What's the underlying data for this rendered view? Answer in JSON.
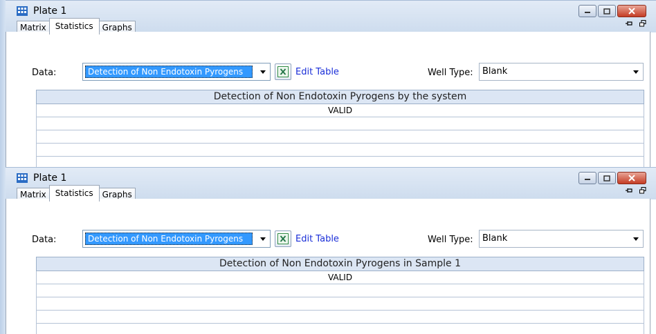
{
  "panels": [
    {
      "window_title": "Plate 1",
      "tabs": [
        "Matrix",
        "Statistics",
        "Graphs"
      ],
      "active_tab": "Statistics",
      "data_label": "Data:",
      "data_selected": "Detection of Non Endotoxin Pyrogens",
      "edit_table_label": "Edit Table",
      "well_type_label": "Well Type:",
      "well_type_value": "Blank",
      "grid_header": "Detection of Non Endotoxin Pyrogens by the system",
      "rows": [
        "VALID",
        "",
        "",
        "",
        ""
      ]
    },
    {
      "window_title": "Plate 1",
      "tabs": [
        "Matrix",
        "Statistics",
        "Graphs"
      ],
      "active_tab": "Statistics",
      "data_label": "Data:",
      "data_selected": "Detection of Non Endotoxin Pyrogens",
      "edit_table_label": "Edit Table",
      "well_type_label": "Well Type:",
      "well_type_value": "Blank",
      "grid_header": "Detection of Non Endotoxin Pyrogens in Sample 1",
      "rows": [
        "VALID",
        "",
        "",
        "",
        ""
      ]
    }
  ],
  "icons": {
    "app": "plate-grid-icon",
    "minimize": "minimize-icon",
    "maximize": "maximize-icon",
    "close": "close-icon",
    "pin": "pin-icon",
    "float": "float-window-icon",
    "excel": "excel-icon",
    "dropdown": "chevron-down-icon"
  },
  "colors": {
    "selection": "#3399ff",
    "link": "#1a2ed8",
    "grid_header_bg": "#dce6f4",
    "close_button": "#c43c24"
  }
}
